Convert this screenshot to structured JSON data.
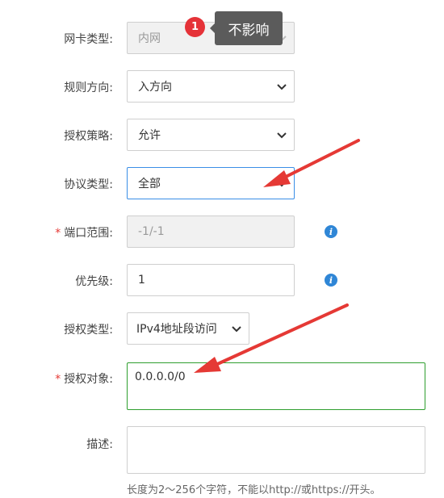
{
  "tooltip": {
    "badge_number": "1",
    "text": "不影响"
  },
  "form": {
    "nic_type": {
      "label": "网卡类型:",
      "value": "内网"
    },
    "direction": {
      "label": "规则方向:",
      "value": "入方向"
    },
    "policy": {
      "label": "授权策略:",
      "value": "允许"
    },
    "protocol": {
      "label": "协议类型:",
      "value": "全部"
    },
    "port_range": {
      "required": "*",
      "label": "端口范围:",
      "value": "-1/-1"
    },
    "priority": {
      "label": "优先级:",
      "value": "1"
    },
    "auth_type": {
      "label": "授权类型:",
      "value": "IPv4地址段访问"
    },
    "auth_object": {
      "required": "*",
      "label": "授权对象:",
      "value": "0.0.0.0/0"
    },
    "description": {
      "label": "描述:",
      "value": "",
      "hint": "长度为2～256个字符，不能以http://或https://开头。"
    }
  },
  "colors": {
    "annotation_arrow": "#e53935",
    "info_icon": "#2f86d6",
    "active_border": "#3a8ee6",
    "success_border": "#2e9e2e"
  }
}
